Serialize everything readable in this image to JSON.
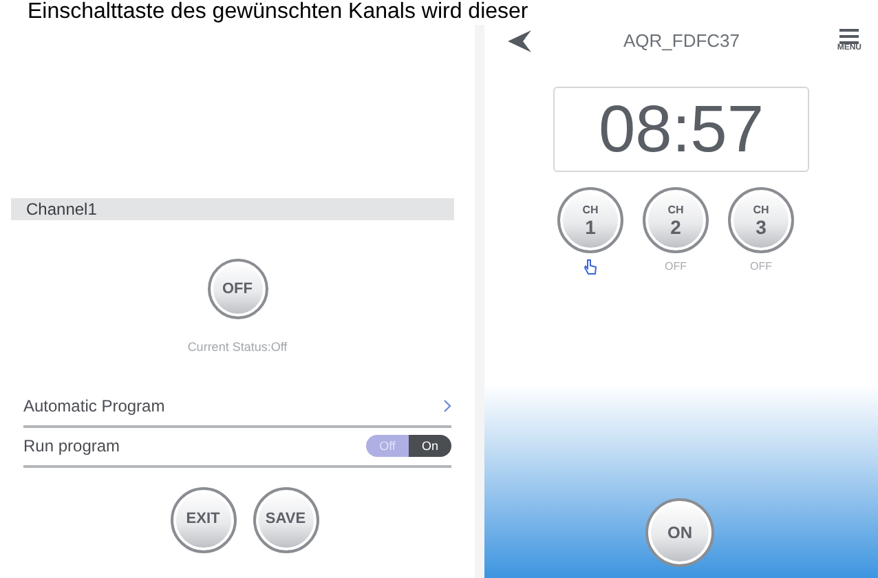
{
  "caption": "Einschalttaste des gewünschten Kanals wird dieser",
  "left": {
    "header": "Channel1",
    "power_button": "OFF",
    "status": "Current Status:Off",
    "rows": [
      {
        "kind": "link",
        "label": "Automatic Program"
      },
      {
        "kind": "toggle",
        "label": "Run program",
        "off_label": "Off",
        "on_label": "On",
        "on": true
      }
    ],
    "buttons": [
      "EXIT",
      "SAVE"
    ]
  },
  "right": {
    "title": "AQR_FDFC37",
    "menu_label": "MENU",
    "clock": "08:57",
    "channels": [
      {
        "prefix": "CH",
        "number": "1",
        "selected": true
      },
      {
        "prefix": "CH",
        "number": "2",
        "selected": false,
        "status": "OFF"
      },
      {
        "prefix": "CH",
        "number": "3",
        "selected": false,
        "status": "OFF"
      }
    ],
    "power_button": "ON"
  }
}
